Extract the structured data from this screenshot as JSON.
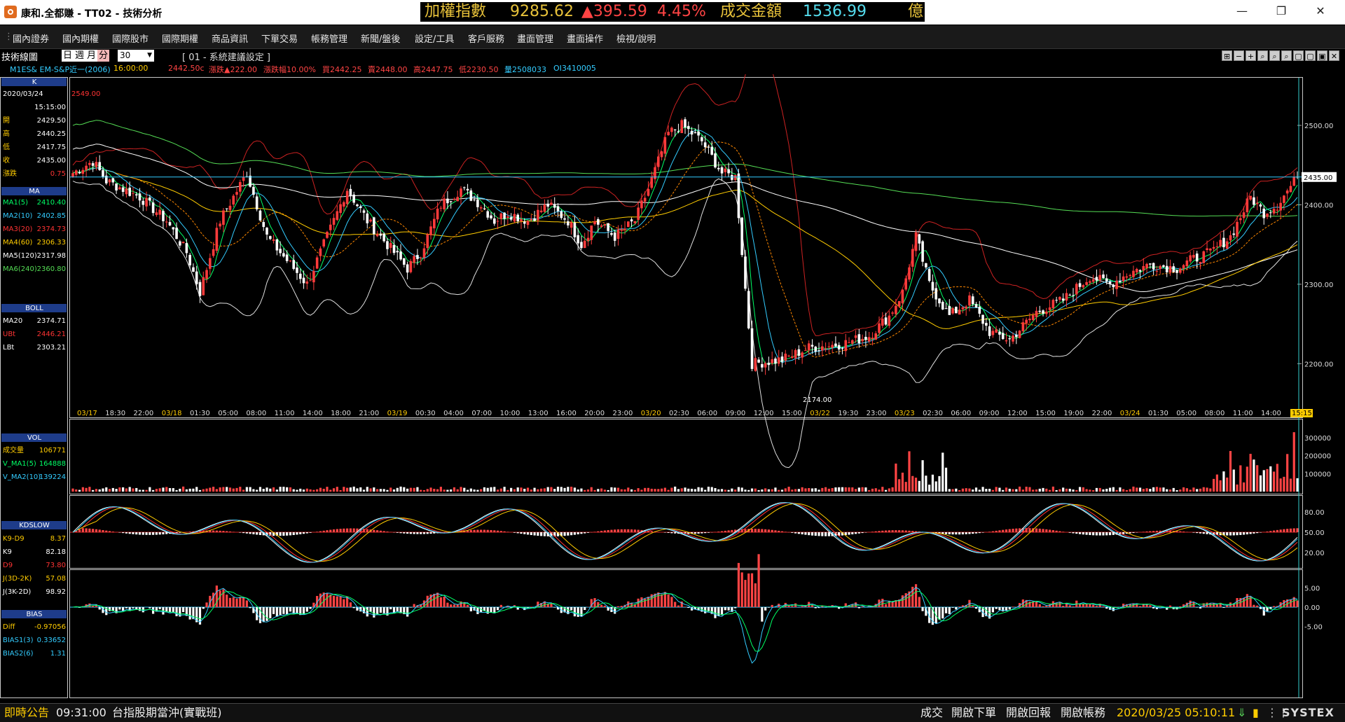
{
  "window": {
    "title": "康和.全都賺 - TT02 - 技術分析",
    "ticker": {
      "name": "加權指數",
      "value": "9285.62",
      "change": "▲395.59",
      "pct": "4.45%",
      "turnover_label": "成交金額",
      "turnover": "1536.99",
      "unit": "億"
    },
    "minimize": "—",
    "restore": "❐",
    "close": "✕"
  },
  "menu": [
    "國內證券",
    "國內期權",
    "國際股市",
    "國際期權",
    "商品資訊",
    "下單交易",
    "帳務管理",
    "新聞/盤後",
    "設定/工具",
    "客戶服務",
    "畫面管理",
    "畫面操作",
    "檢視/說明"
  ],
  "toolbar": {
    "title": "技術線圖",
    "periods": [
      "日",
      "週",
      "月",
      "分"
    ],
    "selected_period": "分",
    "interval": "30",
    "preset": "[ 01 - 系統建議設定 ]",
    "icons": [
      "⊞",
      "−",
      "+",
      "⌕",
      "⌕",
      "⌕",
      "▢",
      "▢",
      "▣",
      "✕"
    ]
  },
  "info": {
    "symbol": "M1ES& EM-S&P近一(2006)",
    "time": "16:00:00",
    "close": "2442.50c",
    "change": "漲跌▲222.00",
    "pct": "漲跌幅10.00%",
    "bid": "買2442.25",
    "ask": "賣2448.00",
    "high": "高2447.75",
    "low": "低2230.50",
    "volume": "量2508033",
    "oi": "OI3410005"
  },
  "left_panel": {
    "k_header": "K",
    "date": "2020/03/24",
    "time": "15:15:00",
    "ohlc": [
      {
        "label": "開",
        "value": "2429.50"
      },
      {
        "label": "高",
        "value": "2440.25"
      },
      {
        "label": "低",
        "value": "2417.75"
      },
      {
        "label": "收",
        "value": "2435.00"
      },
      {
        "label": "漲跌",
        "value": "0.75"
      }
    ],
    "ma_header": "MA",
    "ma": [
      {
        "label": "MA1(5)",
        "value": "2410.40",
        "color": "#00ff66"
      },
      {
        "label": "MA2(10)",
        "value": "2402.85",
        "color": "#33ccff"
      },
      {
        "label": "MA3(20)",
        "value": "2374.73",
        "color": "#ff3333"
      },
      {
        "label": "MA4(60)",
        "value": "2306.33",
        "color": "#ffcc00"
      },
      {
        "label": "MA5(120)",
        "value": "2317.98",
        "color": "#ffffff"
      },
      {
        "label": "MA6(240)",
        "value": "2360.80",
        "color": "#55dd55"
      }
    ],
    "boll_header": "BOLL",
    "boll": [
      {
        "label": "MA20",
        "value": "2374.71",
        "color": "#ffffff"
      },
      {
        "label": "UBt",
        "value": "2446.21",
        "color": "#ff3333"
      },
      {
        "label": "LBt",
        "value": "2303.21",
        "color": "#ffffff"
      }
    ],
    "vol_header": "VOL",
    "vol": [
      {
        "label": "成交量",
        "value": "106771",
        "color": "#ffcc00"
      },
      {
        "label": "V_MA1(5)",
        "value": "164888",
        "color": "#00ff66"
      },
      {
        "label": "V_MA2(10)",
        "value": "139224",
        "color": "#33ccff"
      }
    ],
    "kd_header": "KDSLOW",
    "kd": [
      {
        "label": "K9-D9",
        "value": "8.37",
        "color": "#ffcc00"
      },
      {
        "label": "K9",
        "value": "82.18",
        "color": "#ffffff"
      },
      {
        "label": "D9",
        "value": "73.80",
        "color": "#ff3333"
      },
      {
        "label": "J(3D-2K)",
        "value": "57.08",
        "color": "#ffcc00"
      },
      {
        "label": "J(3K-2D)",
        "value": "98.92",
        "color": "#ffffff"
      }
    ],
    "bias_header": "BIAS",
    "bias": [
      {
        "label": "Diff",
        "value": "-0.97056",
        "color": "#ffcc00"
      },
      {
        "label": "BIAS1(3)",
        "value": "0.33652",
        "color": "#33ccff"
      },
      {
        "label": "BIAS2(6)",
        "value": "1.31",
        "color": "#33ccff"
      }
    ]
  },
  "price_axis": {
    "ticks": [
      "2500.00",
      "2400.00",
      "2300.00",
      "2200.00"
    ],
    "last_price": "2435.00",
    "high_label": "2549.00",
    "low_label": "2174.00"
  },
  "time_axis": {
    "labels": [
      {
        "t": "03/17",
        "date": true
      },
      {
        "t": "18:30"
      },
      {
        "t": "22:00"
      },
      {
        "t": "03/18",
        "date": true
      },
      {
        "t": "01:30"
      },
      {
        "t": "05:00"
      },
      {
        "t": "08:00"
      },
      {
        "t": "11:00"
      },
      {
        "t": "14:00"
      },
      {
        "t": "18:00"
      },
      {
        "t": "21:00"
      },
      {
        "t": "03/19",
        "date": true
      },
      {
        "t": "00:30"
      },
      {
        "t": "04:00"
      },
      {
        "t": "07:00"
      },
      {
        "t": "10:00"
      },
      {
        "t": "13:00"
      },
      {
        "t": "16:00"
      },
      {
        "t": "20:00"
      },
      {
        "t": "23:00"
      },
      {
        "t": "03/20",
        "date": true
      },
      {
        "t": "02:30"
      },
      {
        "t": "06:00"
      },
      {
        "t": "09:00"
      },
      {
        "t": "12:00"
      },
      {
        "t": "15:00"
      },
      {
        "t": "03/22",
        "date": true
      },
      {
        "t": "19:30"
      },
      {
        "t": "23:00"
      },
      {
        "t": "03/23",
        "date": true
      },
      {
        "t": "02:30"
      },
      {
        "t": "06:00"
      },
      {
        "t": "09:00"
      },
      {
        "t": "12:00"
      },
      {
        "t": "15:00"
      },
      {
        "t": "19:00"
      },
      {
        "t": "22:00"
      },
      {
        "t": "03/24",
        "date": true
      },
      {
        "t": "01:30"
      },
      {
        "t": "05:00"
      },
      {
        "t": "08:00"
      },
      {
        "t": "11:00"
      },
      {
        "t": "14:00"
      }
    ],
    "cursor_time": "15:15"
  },
  "vol_axis": {
    "ticks": [
      "300000",
      "200000",
      "100000"
    ]
  },
  "kd_axis": {
    "ticks": [
      "80.00",
      "50.00",
      "20.00"
    ]
  },
  "bias_axis": {
    "ticks": [
      "5.00",
      "0.00",
      "-5.00"
    ]
  },
  "status": {
    "notice_label": "即時公告",
    "time": "09:31:00",
    "message": "台指股期當沖(實戰班)",
    "links": [
      "成交",
      "開啟下單",
      "開啟回報",
      "開啟帳務"
    ],
    "datetime": "2020/03/25 05:10:11",
    "brand": "SYSTEX"
  },
  "chart_data": {
    "type": "candlestick",
    "title": "M1ES& EM-S&P近一(2006) 30分 K線",
    "ylim": [
      2150,
      2560
    ],
    "anchors": [
      [
        0,
        2440
      ],
      [
        6,
        2455
      ],
      [
        10,
        2430
      ],
      [
        20,
        2410
      ],
      [
        28,
        2380
      ],
      [
        34,
        2340
      ],
      [
        38,
        2290
      ],
      [
        44,
        2380
      ],
      [
        52,
        2440
      ],
      [
        58,
        2360
      ],
      [
        66,
        2320
      ],
      [
        70,
        2300
      ],
      [
        76,
        2360
      ],
      [
        82,
        2420
      ],
      [
        88,
        2380
      ],
      [
        92,
        2360
      ],
      [
        100,
        2320
      ],
      [
        104,
        2340
      ],
      [
        110,
        2400
      ],
      [
        116,
        2420
      ],
      [
        122,
        2400
      ],
      [
        126,
        2380
      ],
      [
        130,
        2390
      ],
      [
        136,
        2380
      ],
      [
        142,
        2400
      ],
      [
        148,
        2380
      ],
      [
        152,
        2350
      ],
      [
        156,
        2380
      ],
      [
        162,
        2360
      ],
      [
        168,
        2380
      ],
      [
        172,
        2420
      ],
      [
        178,
        2490
      ],
      [
        182,
        2500
      ],
      [
        188,
        2480
      ],
      [
        194,
        2440
      ],
      [
        198,
        2435
      ],
      [
        203,
        2200
      ],
      [
        212,
        2205
      ],
      [
        220,
        2220
      ],
      [
        230,
        2225
      ],
      [
        238,
        2235
      ],
      [
        244,
        2260
      ],
      [
        248,
        2290
      ],
      [
        252,
        2360
      ],
      [
        256,
        2300
      ],
      [
        262,
        2260
      ],
      [
        268,
        2280
      ],
      [
        274,
        2240
      ],
      [
        280,
        2230
      ],
      [
        288,
        2265
      ],
      [
        296,
        2280
      ],
      [
        304,
        2310
      ],
      [
        310,
        2300
      ],
      [
        316,
        2315
      ],
      [
        322,
        2325
      ],
      [
        330,
        2320
      ],
      [
        334,
        2330
      ],
      [
        340,
        2340
      ],
      [
        346,
        2360
      ],
      [
        352,
        2410
      ],
      [
        356,
        2390
      ],
      [
        360,
        2400
      ],
      [
        366,
        2435
      ]
    ],
    "bars": 367,
    "last_close": 2435.0
  }
}
